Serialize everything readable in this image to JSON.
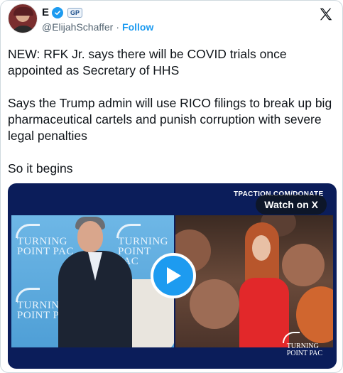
{
  "author": {
    "display_name": "E",
    "handle": "@ElijahSchaffer",
    "separator": "·",
    "follow_label": "Follow",
    "affiliate_badge": "GP",
    "verified": true
  },
  "tweet": {
    "paragraphs": [
      "NEW: RFK Jr. says there will be COVID trials once appointed as Secretary of HHS",
      "Says the Trump admin will use RICO filings to break up big pharmaceutical cartels and punish corruption with severe legal penalties",
      "So it begins"
    ]
  },
  "media": {
    "watch_label": "Watch on X",
    "ribbon_text": "TPACTION.COM/DONATE",
    "left_logo_line1": "TURNING",
    "left_logo_line2": "POINT PAC",
    "corner_logo_line1": "TURNING",
    "corner_logo_line2": "POINT PAC"
  },
  "icons": {
    "x_logo": "x-logo-icon",
    "verified": "verified-check-icon",
    "play": "play-icon"
  },
  "colors": {
    "accent": "#1d9bf0",
    "text": "#0f1419",
    "secondary": "#536471"
  }
}
